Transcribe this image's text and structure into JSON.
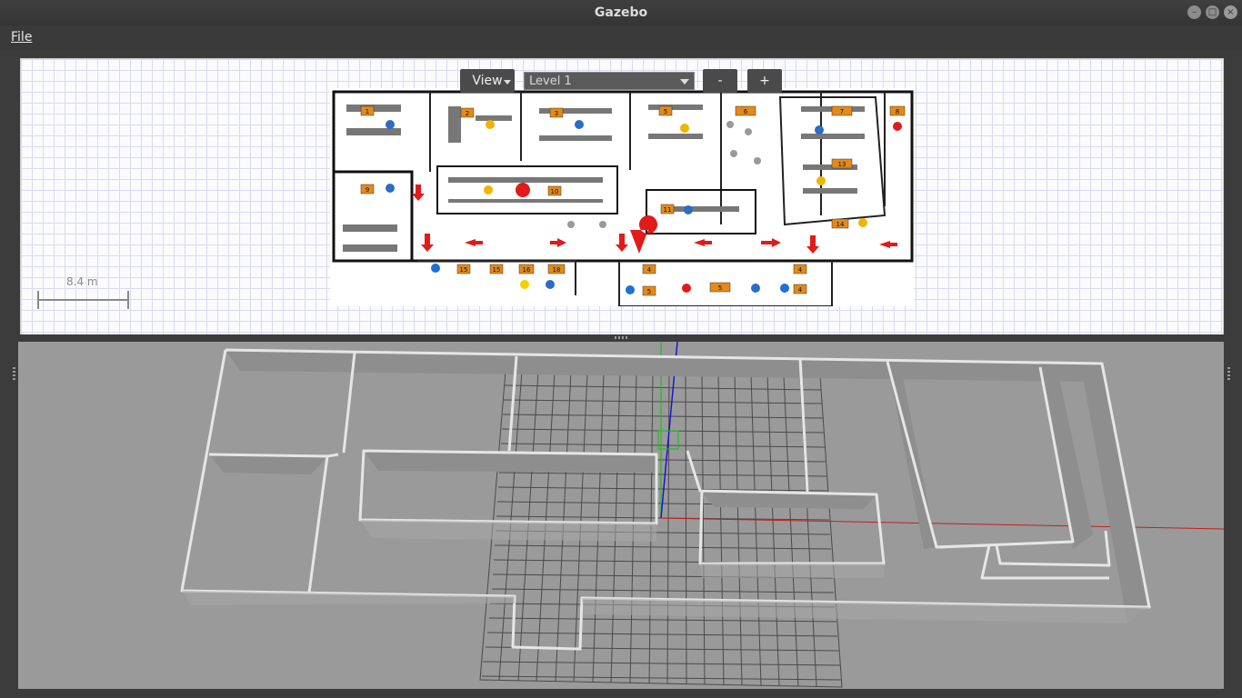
{
  "window": {
    "title": "Gazebo"
  },
  "window_controls": {
    "minimize": "–",
    "maximize": "□",
    "close": "×"
  },
  "menu": {
    "file": "File"
  },
  "plan_toolbar": {
    "view_label": "View",
    "level_value": "Level 1",
    "zoom_out_label": "-",
    "zoom_in_label": "+"
  },
  "scale": {
    "label": "8.4 m"
  },
  "floorplan": {
    "rooms": [
      "1",
      "2",
      "3",
      "5",
      "6",
      "7",
      "8",
      "9",
      "10",
      "11",
      "13",
      "14",
      "15",
      "15",
      "16",
      "18",
      "4",
      "5",
      "5",
      "4",
      "4"
    ]
  },
  "colors": {
    "wall_red": "#e11a1a",
    "room_tag": "#e38a18",
    "axis_x": "#d01010",
    "axis_y": "#10c010",
    "axis_z": "#1010d0"
  }
}
